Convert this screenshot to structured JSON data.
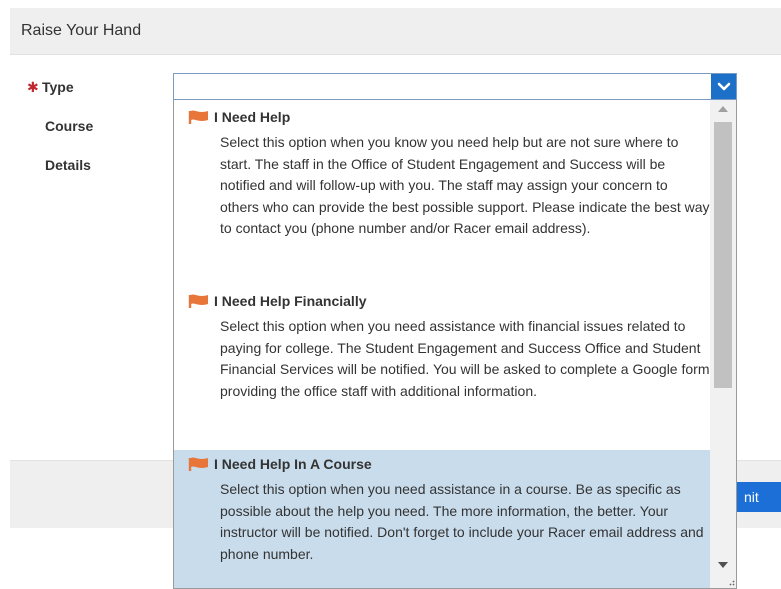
{
  "dialog": {
    "title": "Raise Your Hand"
  },
  "form": {
    "required_marker": "✱",
    "labels": {
      "type": "Type",
      "course": "Course",
      "details": "Details"
    },
    "type_select_value": ""
  },
  "footer": {
    "submit_label": "nit"
  },
  "dropdown": {
    "options": [
      {
        "title": "I Need Help",
        "description": "Select this option when you know you need help but are not sure where to start. The staff in the Office of Student Engagement and Success will be notified and will follow-up with you. The staff may assign your concern to others who can provide the best possible support. Please indicate the best way to contact you (phone number and/or Racer email address).",
        "selected": false
      },
      {
        "title": "I Need Help Financially",
        "description": "Select this option when you need assistance with financial issues related to paying for college. The Student Engagement and Success Office and Student Financial Services will be notified. You will be asked to complete a Google form providing the office staff with additional information.",
        "selected": false
      },
      {
        "title": "I Need Help In A Course",
        "description": "Select this option when you need assistance in a course. Be as specific as possible about the help you need. The more information, the better. Your instructor will be notified. Don't forget to include your Racer email address and phone number.",
        "selected": true
      }
    ]
  },
  "colors": {
    "accent": "#1d70c8",
    "flag": "#e8753a",
    "selected_row": "#c9dcec",
    "required": "#c1272d"
  },
  "icons": {
    "option_icon": "flag-icon",
    "select_icon": "chevron-down-icon"
  }
}
